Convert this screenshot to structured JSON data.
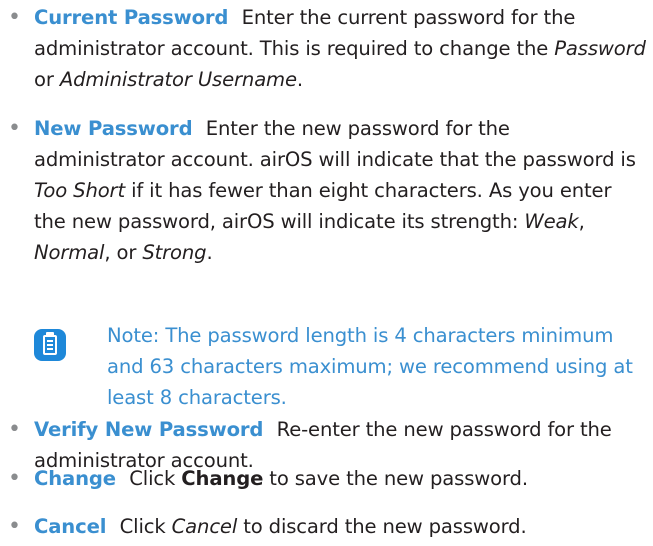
{
  "items": [
    {
      "term": "Current Password",
      "t1": "Enter the current password for the administrator account. This is required to change the ",
      "i1": "Password",
      "t2": " or ",
      "i2": "Administrator Username",
      "t3": "."
    },
    {
      "term": "New Password",
      "t1": "Enter the new password for the administrator account. airOS will indicate that the password is ",
      "i1": "Too Short",
      "t2": " if it has fewer than eight characters. As you enter the new password, airOS will indicate its strength: ",
      "i2": "Weak",
      "t3": ", ",
      "i3": "Normal",
      "t4": ", or ",
      "i4": "Strong",
      "t5": "."
    },
    {
      "term": "Verify New Password",
      "t1": "Re-enter the new password for the administrator account."
    },
    {
      "term": "Change",
      "t1": "Click ",
      "b1": "Change",
      "t2": " to save the new password."
    },
    {
      "term": "Cancel",
      "t1": "Click ",
      "i1": "Cancel",
      "t2": " to discard the new password."
    }
  ],
  "note": {
    "label": "Note:",
    "text": " The password length is 4 characters minimum and 63 characters maximum; we recommend using at least 8 characters.",
    "icon": "note-icon",
    "color": "#1e88d9"
  },
  "bullet_char": "•",
  "colors": {
    "term": "#3a8fd0",
    "body": "#231f20",
    "bullet": "#8a8c8e"
  }
}
